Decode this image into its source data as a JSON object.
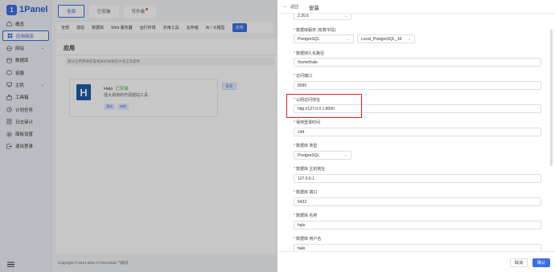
{
  "brand": {
    "name": "1Panel",
    "mark": "1"
  },
  "sidebar": {
    "items": [
      {
        "label": "概览",
        "icon": "home-icon"
      },
      {
        "label": "应用商店",
        "icon": "app-store-icon",
        "active": true
      },
      {
        "label": "网站",
        "icon": "globe-icon",
        "arrow": "⌄"
      },
      {
        "label": "数据库",
        "icon": "database-icon"
      },
      {
        "label": "容器",
        "icon": "container-icon"
      },
      {
        "label": "主机",
        "icon": "host-icon",
        "arrow": "⌄"
      },
      {
        "label": "工具箱",
        "icon": "toolbox-icon"
      },
      {
        "label": "计划任务",
        "icon": "schedule-icon"
      },
      {
        "label": "日志审计",
        "icon": "log-icon"
      },
      {
        "label": "面板设置",
        "icon": "settings-icon"
      },
      {
        "label": "退出登录",
        "icon": "logout-icon"
      }
    ]
  },
  "top_tabs": [
    {
      "label": "全部",
      "active": true
    },
    {
      "label": "已安装"
    },
    {
      "label": "可升级",
      "dot": true
    }
  ],
  "categories": [
    "全部",
    "建站",
    "数据库",
    "Web 服务器",
    "运行环境",
    "实用工具",
    "云存储",
    "AI / 大模型",
    "本地"
  ],
  "panel": {
    "title": "应用",
    "hint": "部分应用需要配置相关的依赖后才能正常使用"
  },
  "app_card": {
    "logo": "H",
    "name": "Halo",
    "status": "已安装",
    "desc": "强大易用的开源建站工具",
    "tags": [
      "建站",
      "本地"
    ],
    "install": "安装"
  },
  "footer": {
    "copyright": "Copyright © 2014-2024 FIT2CLOUD 飞致云"
  },
  "drawer": {
    "back": "返回",
    "title": "安装",
    "version_value": "2.20.6",
    "fields": {
      "db_service_label": "数据库服务 (有数字段)",
      "db_service_type": "PostgreSQL",
      "db_service_name": "Local_PostgreSQL_16",
      "data_path_label": "数据持久化路径",
      "data_path_value": "/home/halo",
      "port_label": "访问端口",
      "port_value": "8090",
      "public_url_label": "公网访问地址",
      "public_url_value": "http://127.0.0.1:8090",
      "session_label": "保持登录时间",
      "session_value": "144",
      "db_type_label": "数据库 类型",
      "db_type_value": "PostgreSQL",
      "db_host_label": "数据库 主机地址",
      "db_host_value": "127.0.0.1",
      "db_port_label": "数据库 端口",
      "db_port_value": "5432",
      "db_name_label": "数据库 名称",
      "db_name_value": "halo",
      "db_user_label": "数据库 用户名",
      "db_user_value": "halo"
    },
    "cancel": "取消",
    "confirm": "确认"
  },
  "colors": {
    "accent": "#3b6fe6",
    "highlight": "#e02020",
    "required": "#e53935"
  }
}
